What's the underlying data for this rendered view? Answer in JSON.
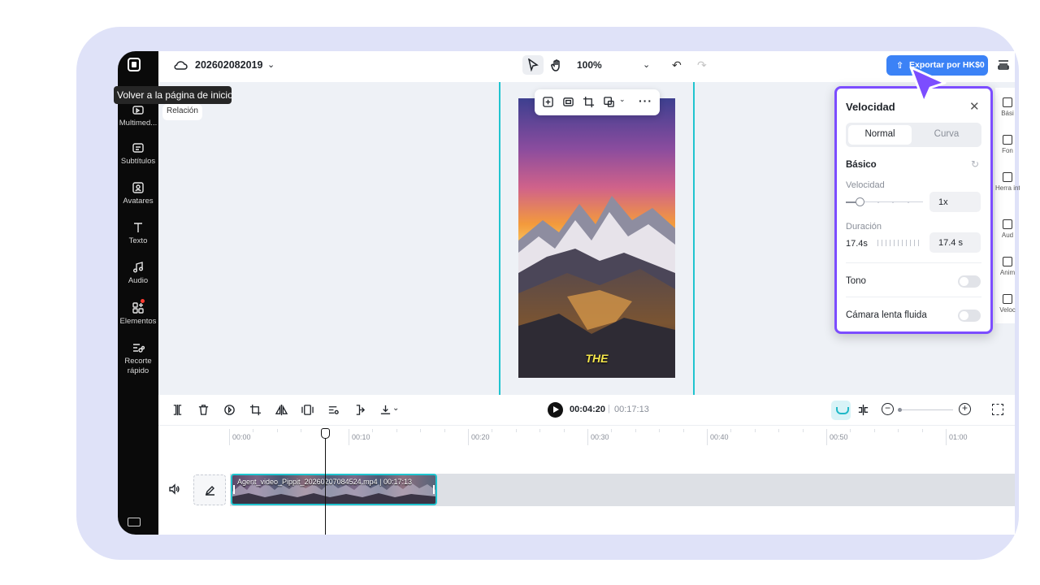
{
  "app": {
    "project_name": "202602082019",
    "zoom": "100%",
    "export_label": "Exportar por HK$0",
    "back_tooltip": "Volver a la página de inicio",
    "ratio_label": "Relación"
  },
  "sidebar": {
    "items": [
      {
        "label": "Multimed...",
        "icon": "media-icon"
      },
      {
        "label": "Subtítulos",
        "icon": "subtitles-icon"
      },
      {
        "label": "Avatares",
        "icon": "avatar-icon"
      },
      {
        "label": "Texto",
        "icon": "text-icon"
      },
      {
        "label": "Audio",
        "icon": "music-icon"
      },
      {
        "label": "Elementos",
        "icon": "elements-icon"
      },
      {
        "label": "Recorte rápido",
        "icon": "quick-cut-icon"
      }
    ]
  },
  "right_rail": {
    "items": [
      "Bási",
      "Fon",
      "Herra intelig",
      "Aud",
      "Anim",
      "Veloc"
    ]
  },
  "preview": {
    "overlay_text": "THE"
  },
  "speed_panel": {
    "title": "Velocidad",
    "tabs": [
      "Normal",
      "Curva"
    ],
    "active_tab": "Normal",
    "section_basic": "Básico",
    "speed_label": "Velocidad",
    "speed_value": "1x",
    "speed_level": 0.1,
    "duration_label": "Duración",
    "duration_original": "17.4s",
    "duration_value": "17.4 s",
    "tone_label": "Tono",
    "tone_on": false,
    "smooth_label": "Cámara lenta fluida",
    "smooth_on": false
  },
  "timeline": {
    "current_time": "00:04:20",
    "total_time": "00:17:13",
    "ruler": [
      "00:00",
      "00:10",
      "00:20",
      "00:30",
      "00:40",
      "00:50",
      "01:00"
    ],
    "clip_name": "Agent_video_Pippit_20260207084524.mp4",
    "clip_duration": "00:17:13"
  },
  "colors": {
    "accent": "#7c4dff",
    "export_button": "#3b82f6",
    "guide": "#20c4cf"
  }
}
